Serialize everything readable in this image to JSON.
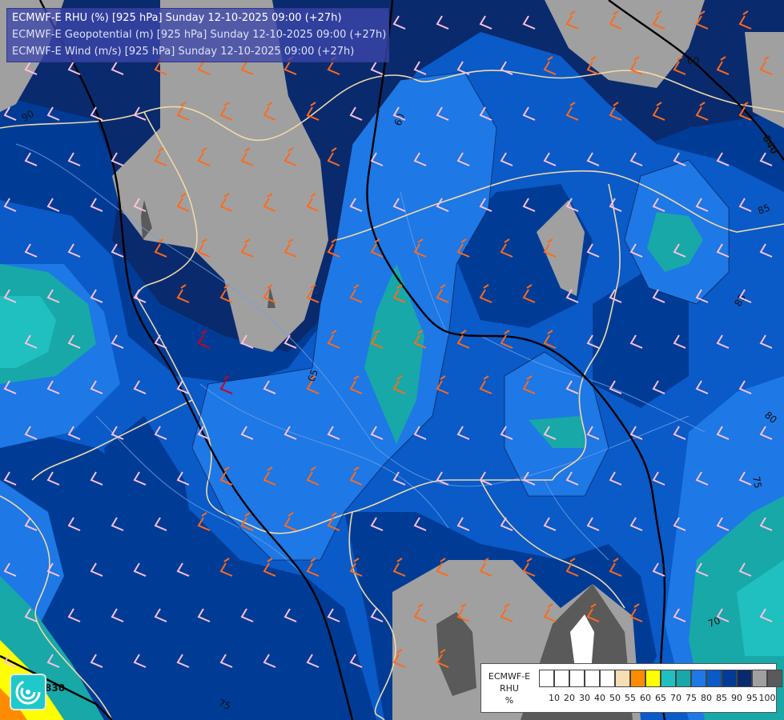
{
  "header": {
    "line1": "ECMWF-E RHU (%) [925 hPa] Sunday 12-10-2025 09:00 (+27h)",
    "line2": "ECMWF-E Geopotential (m) [925 hPa] Sunday 12-10-2025 09:00 (+27h)",
    "line3": "ECMWF-E Wind (m/s) [925 hPa] Sunday 12-10-2025 09:00 (+27h)"
  },
  "contour_labels": {
    "rh_60": "60",
    "rh_65": "65",
    "rh_70": "70",
    "rh_75": "75",
    "rh_75b": "75",
    "rh_80": "80",
    "rh_80b": "80",
    "rh_85": "85",
    "rh_85b": "85",
    "rh_90": "90",
    "rh_60b": "60",
    "geo_840": "840",
    "geo_830": "830"
  },
  "legend": {
    "title_line1": "ECMWF-E",
    "title_line2": "RHU",
    "unit": "%",
    "bins": [
      {
        "label": "10",
        "color": "#ffffff"
      },
      {
        "label": "20",
        "color": "#ffffff"
      },
      {
        "label": "30",
        "color": "#ffffff"
      },
      {
        "label": "40",
        "color": "#ffffff"
      },
      {
        "label": "50",
        "color": "#ffffff"
      },
      {
        "label": "55",
        "color": "#f5deb3"
      },
      {
        "label": "60",
        "color": "#ff8c00"
      },
      {
        "label": "65",
        "color": "#ffff00"
      },
      {
        "label": "70",
        "color": "#20c0c0"
      },
      {
        "label": "75",
        "color": "#18a8a8"
      },
      {
        "label": "80",
        "color": "#1e78e6"
      },
      {
        "label": "85",
        "color": "#0a5ac8"
      },
      {
        "label": "90",
        "color": "#003c96"
      },
      {
        "label": "95",
        "color": "#0a2a6e"
      },
      {
        "label": "100",
        "color": "#a0a0a0"
      }
    ],
    "last_color": "#5a5a5a"
  },
  "colors": {
    "rh_95": "#0a2a6e",
    "rh_90": "#003c96",
    "rh_85": "#0a5ac8",
    "rh_80": "#1e78e6",
    "rh_75": "#18a8a8",
    "rh_70": "#20c0c0",
    "rh_100": "#a0a0a0",
    "rh_max": "#5a5a5a",
    "border": "#f0d9a8",
    "river": "#6ea0e6",
    "geopotential": "#000000",
    "wind_strong": "#ff6a1a",
    "wind_weak": "#ffc0e0",
    "wind_red": "#cc0022"
  },
  "logo_icon": "ecmwf-logo-icon"
}
